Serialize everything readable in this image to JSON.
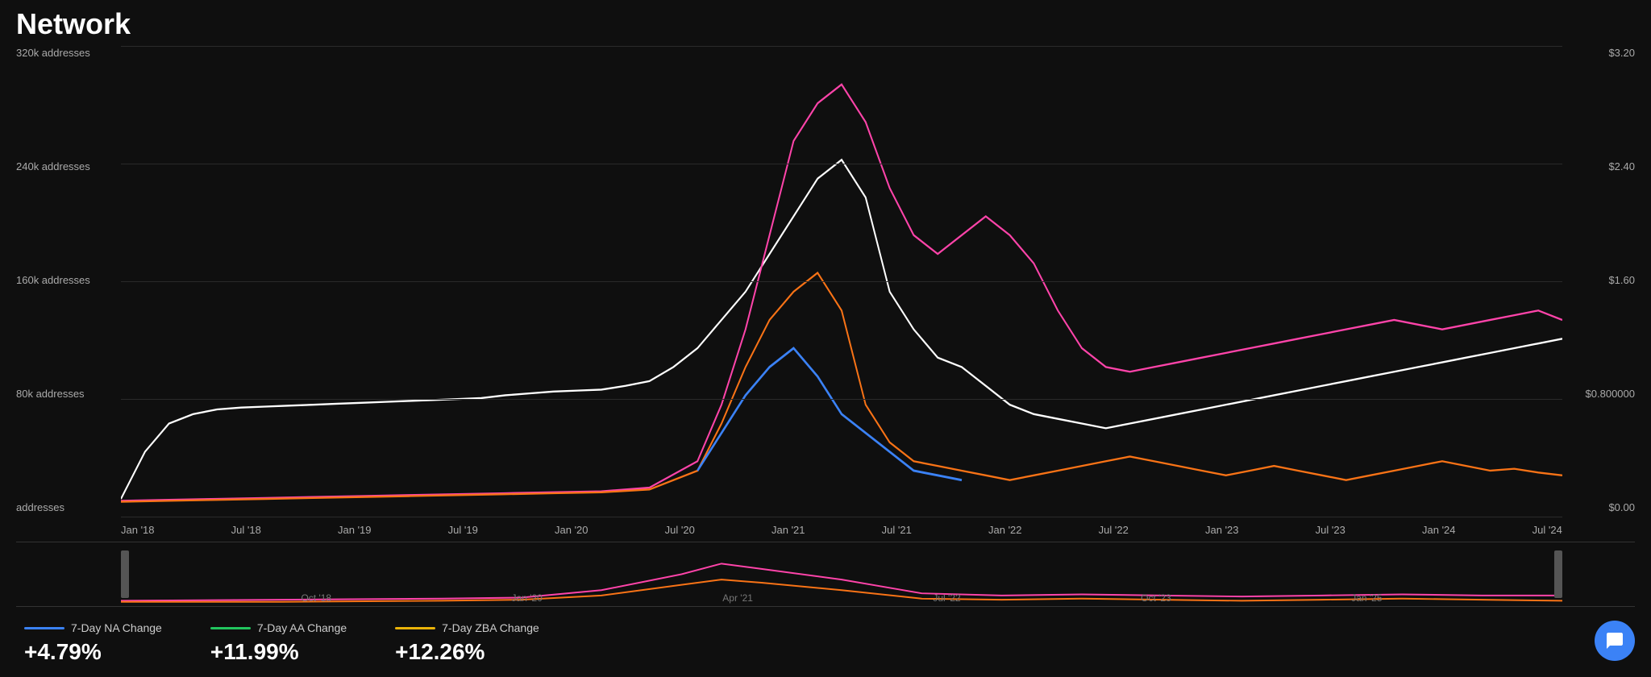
{
  "header": {
    "title": "Network"
  },
  "chart": {
    "y_axis_left": [
      {
        "label": "addresses",
        "value": 0
      },
      {
        "label": "80k addresses",
        "value": 80000
      },
      {
        "label": "160k addresses",
        "value": 160000
      },
      {
        "label": "240k addresses",
        "value": 240000
      },
      {
        "label": "320k addresses",
        "value": 320000
      }
    ],
    "y_axis_right": [
      {
        "label": "$0.00"
      },
      {
        "label": "$0.800000"
      },
      {
        "label": "$1.60"
      },
      {
        "label": "$2.40"
      },
      {
        "label": "$3.20"
      }
    ],
    "x_axis": [
      "Jan '18",
      "Jul '18",
      "Jan '19",
      "Jul '19",
      "Jan '20",
      "Jul '20",
      "Jan '21",
      "Jul '21",
      "Jan '22",
      "Jul '22",
      "Jan '23",
      "Jul '23",
      "Jan '24",
      "Jul '24"
    ],
    "mini_x_axis": [
      "Oct '18",
      "Jan '20",
      "Apr '21",
      "Jul '22",
      "Oct '23",
      "Jan '25"
    ]
  },
  "legend": {
    "items": [
      {
        "label": "7-Day NA Change",
        "color": "#3b82f6",
        "value": "+4.79%"
      },
      {
        "label": "7-Day AA Change",
        "color": "#22c55e",
        "value": "+11.99%"
      },
      {
        "label": "7-Day ZBA Change",
        "color": "#eab308",
        "value": "+12.26%"
      }
    ]
  },
  "chat_button": {
    "label": "Chat"
  }
}
